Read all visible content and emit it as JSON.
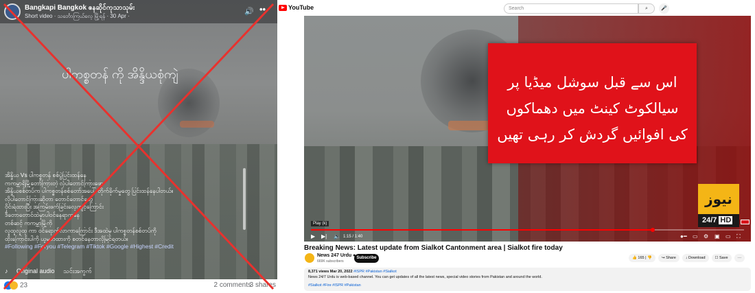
{
  "facebook": {
    "page_name": "Bangkapi Bangkok ဧနဆိုင်ကုသာသုမ်း",
    "meta": "Short video · သင်္ဘောကြယ်လေ့ မြို့ရန် · 30 Apr ·",
    "overlay_headline": "ပါကစ္စတန် ကို အိန္ဒိယစုံကျဲ",
    "caption_lines": [
      "အိန္ဒိယ Vs ပါကစ္စတန် စစ်ပွဲပြင်းထန်နေ",
      "ကကမ္ဘာရှိမြို့တော်ကြားတဲ့ လုံပါတောင်ကြားဖော",
      "အိန္ဒိယစစ်တပ်က ပါကစ္စတန်စစ်တော်အပေါ် တိုက်ခိုက်မှုတွေ ပြင်းထန်နေပါတယ်။",
      "လိုပါတောင်ကြားဆိုတာ တောင်တောင်တွေ",
      "ဝိုင်းရံထားပြီး အကြမ်းဖက်ခြင်းလေ့ကျင့်ကြောင်း",
      "ဒီတောတောင်ထဲမှာပါဝင်နေရာကနေ",
      "တစ်ဆင့် ကကမ္ဘာမြို့ကို",
      "လူထူလူထု ကာ ဝင်ရောက်လာကာကြောင်း ဒီအထဲမှ ပါကစ္စတန်စစ်တပ်ကို",
      "ထိုးကြောင်းပါကို ယူမှတ်ထားကို စတင်နေတာလိုမြင်ရတယ်။"
    ],
    "hashtags": "#Following #Foryou #Telegram #Tiktok #Google #Highest #Credit",
    "audio_label": "Original audio",
    "audio_channel": "သင်းအကွက်",
    "reaction_count": "23",
    "comments": "2 comments",
    "shares": "3 shares"
  },
  "youtube": {
    "logo_text": "YouTube",
    "search_placeholder": "Search",
    "urdu_headline": "اس سے قبل سوشل میڈیا پر سیالکوٹ کینٹ میں دھماکوں کی افوائیں گردش کر رہی تھیں",
    "news_logo_top": "نیوز",
    "news_logo_bottom": "24/7",
    "news_logo_hd": "HD",
    "play_tooltip": "Play (k)",
    "time": "1:15 / 1:40",
    "progress": 0.79,
    "title": "Breaking News: Latest update from Sialkot Cantonment area | Sialkot fire today",
    "channel_name": "News 247 Urdu",
    "subscribers": "669K subscribers",
    "subscribe_label": "Subscribe",
    "likes": "165",
    "share_label": "Share",
    "download_label": "Download",
    "save_label": "Save",
    "more_label": "···",
    "desc_stats": "8,371 views  Mar 20, 2022",
    "desc_stats_tags": "#ISPR #Pakistan #Sialkot",
    "desc_text": "News 24/7 Urdu is web-based channel. You can get updates of all the latest news, special video stories from Pakistan and around the world.",
    "desc_tags": "#Sialkot #Fire #ISPR #Pakistan"
  }
}
